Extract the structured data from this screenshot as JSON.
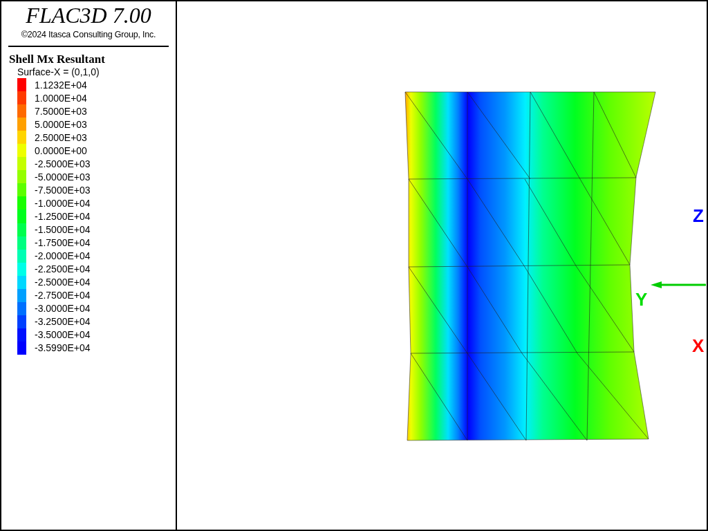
{
  "header": {
    "title": "FLAC3D 7.00",
    "copyright": "©2024 Itasca Consulting Group, Inc."
  },
  "legend": {
    "title": "Shell Mx Resultant",
    "subtitle": "Surface-X = (0,1,0)",
    "items": [
      {
        "label": "1.1232E+04",
        "color": "#ff0000"
      },
      {
        "label": "1.0000E+04",
        "color": "#ff3a00"
      },
      {
        "label": "7.5000E+03",
        "color": "#ff6a00"
      },
      {
        "label": "5.0000E+03",
        "color": "#ffa000"
      },
      {
        "label": "2.5000E+03",
        "color": "#ffd500"
      },
      {
        "label": "0.0000E+00",
        "color": "#eeff00"
      },
      {
        "label": "-2.5000E+03",
        "color": "#c4ff00"
      },
      {
        "label": "-5.0000E+03",
        "color": "#94ff00"
      },
      {
        "label": "-7.5000E+03",
        "color": "#5cff00"
      },
      {
        "label": "-1.0000E+04",
        "color": "#1aff00"
      },
      {
        "label": "-1.2500E+04",
        "color": "#00ff1e"
      },
      {
        "label": "-1.5000E+04",
        "color": "#00ff4e"
      },
      {
        "label": "-1.7500E+04",
        "color": "#00ff80"
      },
      {
        "label": "-2.0000E+04",
        "color": "#00ffb4"
      },
      {
        "label": "-2.2500E+04",
        "color": "#00ffe8"
      },
      {
        "label": "-2.5000E+04",
        "color": "#00d8ff"
      },
      {
        "label": "-2.7500E+04",
        "color": "#00a0ff"
      },
      {
        "label": "-3.0000E+04",
        "color": "#0070ff"
      },
      {
        "label": "-3.2500E+04",
        "color": "#0040ff"
      },
      {
        "label": "-3.5000E+04",
        "color": "#0010ff"
      },
      {
        "label": "-3.5990E+04",
        "color": "#0000ff"
      }
    ]
  },
  "axes": [
    {
      "label": "Z",
      "color": "#0000ff"
    },
    {
      "label": "Y",
      "color": "#00dd00"
    },
    {
      "label": "X",
      "color": "#ff0000"
    }
  ]
}
